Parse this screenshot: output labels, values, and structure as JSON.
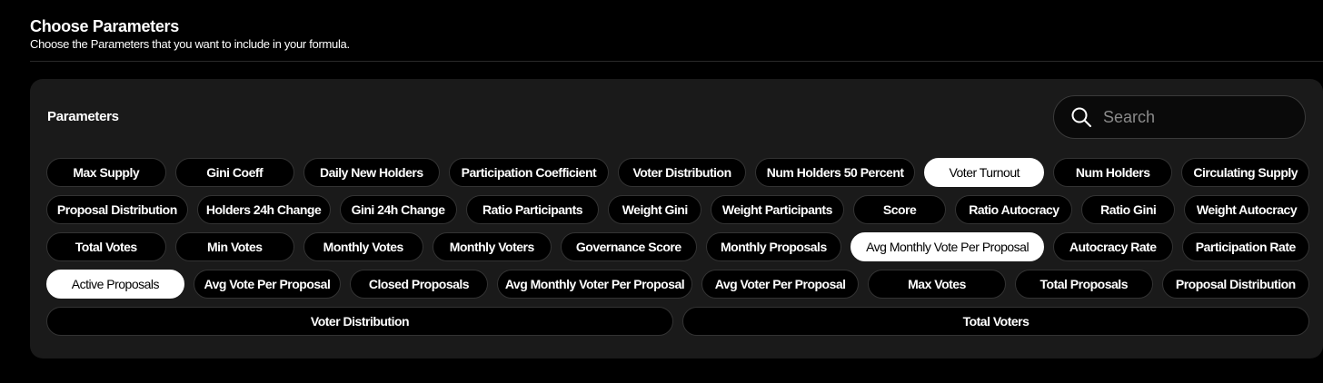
{
  "header": {
    "title": "Choose Parameters",
    "subtitle": "Choose the Parameters that you want to include in your formula."
  },
  "panel": {
    "title": "Parameters",
    "search": {
      "placeholder": "Search",
      "value": "",
      "icon": "search-icon"
    }
  },
  "rows": [
    [
      {
        "label": "Max Supply",
        "selected": false,
        "grow": 1.3
      },
      {
        "label": "Gini Coeff",
        "selected": false,
        "grow": 1.3
      },
      {
        "label": "Daily New Holders",
        "selected": false,
        "grow": 1.5
      },
      {
        "label": "Participation Coefficient",
        "selected": false,
        "grow": 1.8
      },
      {
        "label": "Voter Distribution",
        "selected": false,
        "grow": 1.4
      },
      {
        "label": "Num Holders 50 Percent",
        "selected": false,
        "grow": 1.8
      },
      {
        "label": "Voter Turnout",
        "selected": true,
        "grow": 1.3
      },
      {
        "label": "Num Holders",
        "selected": false,
        "grow": 1.3
      },
      {
        "label": "Circulating Supply",
        "selected": false,
        "grow": 1.4
      }
    ],
    [
      {
        "label": "Proposal Distribution",
        "selected": false,
        "grow": 1.6
      },
      {
        "label": "Holders 24h Change",
        "selected": false,
        "grow": 1.5
      },
      {
        "label": "Gini 24h Change",
        "selected": false,
        "grow": 1.3
      },
      {
        "label": "Ratio Participants",
        "selected": false,
        "grow": 1.5
      },
      {
        "label": "Weight Gini",
        "selected": false,
        "grow": 1.0
      },
      {
        "label": "Weight Participants",
        "selected": false,
        "grow": 1.5
      },
      {
        "label": "Score",
        "selected": false,
        "grow": 1.0
      },
      {
        "label": "Ratio Autocracy",
        "selected": false,
        "grow": 1.3
      },
      {
        "label": "Ratio Gini",
        "selected": false,
        "grow": 1.0
      },
      {
        "label": "Weight Autocracy",
        "selected": false,
        "grow": 1.4
      }
    ],
    [
      {
        "label": "Total Votes",
        "selected": false,
        "grow": 1.3
      },
      {
        "label": "Min Votes",
        "selected": false,
        "grow": 1.3
      },
      {
        "label": "Monthly Votes",
        "selected": false,
        "grow": 1.3
      },
      {
        "label": "Monthly Voters",
        "selected": false,
        "grow": 1.3
      },
      {
        "label": "Governance Score",
        "selected": false,
        "grow": 1.5
      },
      {
        "label": "Monthly Proposals",
        "selected": false,
        "grow": 1.5
      },
      {
        "label": "Avg Monthly Vote Per Proposal",
        "selected": true,
        "grow": 2.2
      },
      {
        "label": "Autocracy Rate",
        "selected": false,
        "grow": 1.3
      },
      {
        "label": "Participation Rate",
        "selected": false,
        "grow": 1.4
      }
    ],
    [
      {
        "label": "Active Proposals",
        "selected": true,
        "grow": 1.3
      },
      {
        "label": "Avg Vote Per Proposal",
        "selected": false,
        "grow": 1.4
      },
      {
        "label": "Closed Proposals",
        "selected": false,
        "grow": 1.3
      },
      {
        "label": "Avg Monthly Voter Per Proposal",
        "selected": false,
        "grow": 1.9
      },
      {
        "label": "Avg Voter Per Proposal",
        "selected": false,
        "grow": 1.5
      },
      {
        "label": "Max Votes",
        "selected": false,
        "grow": 1.3
      },
      {
        "label": "Total Proposals",
        "selected": false,
        "grow": 1.3
      },
      {
        "label": "Proposal Distribution",
        "selected": false,
        "grow": 1.4
      }
    ],
    [
      {
        "label": "Voter Distribution",
        "selected": false,
        "grow": 1
      },
      {
        "label": "Total Voters",
        "selected": false,
        "grow": 1
      }
    ]
  ]
}
